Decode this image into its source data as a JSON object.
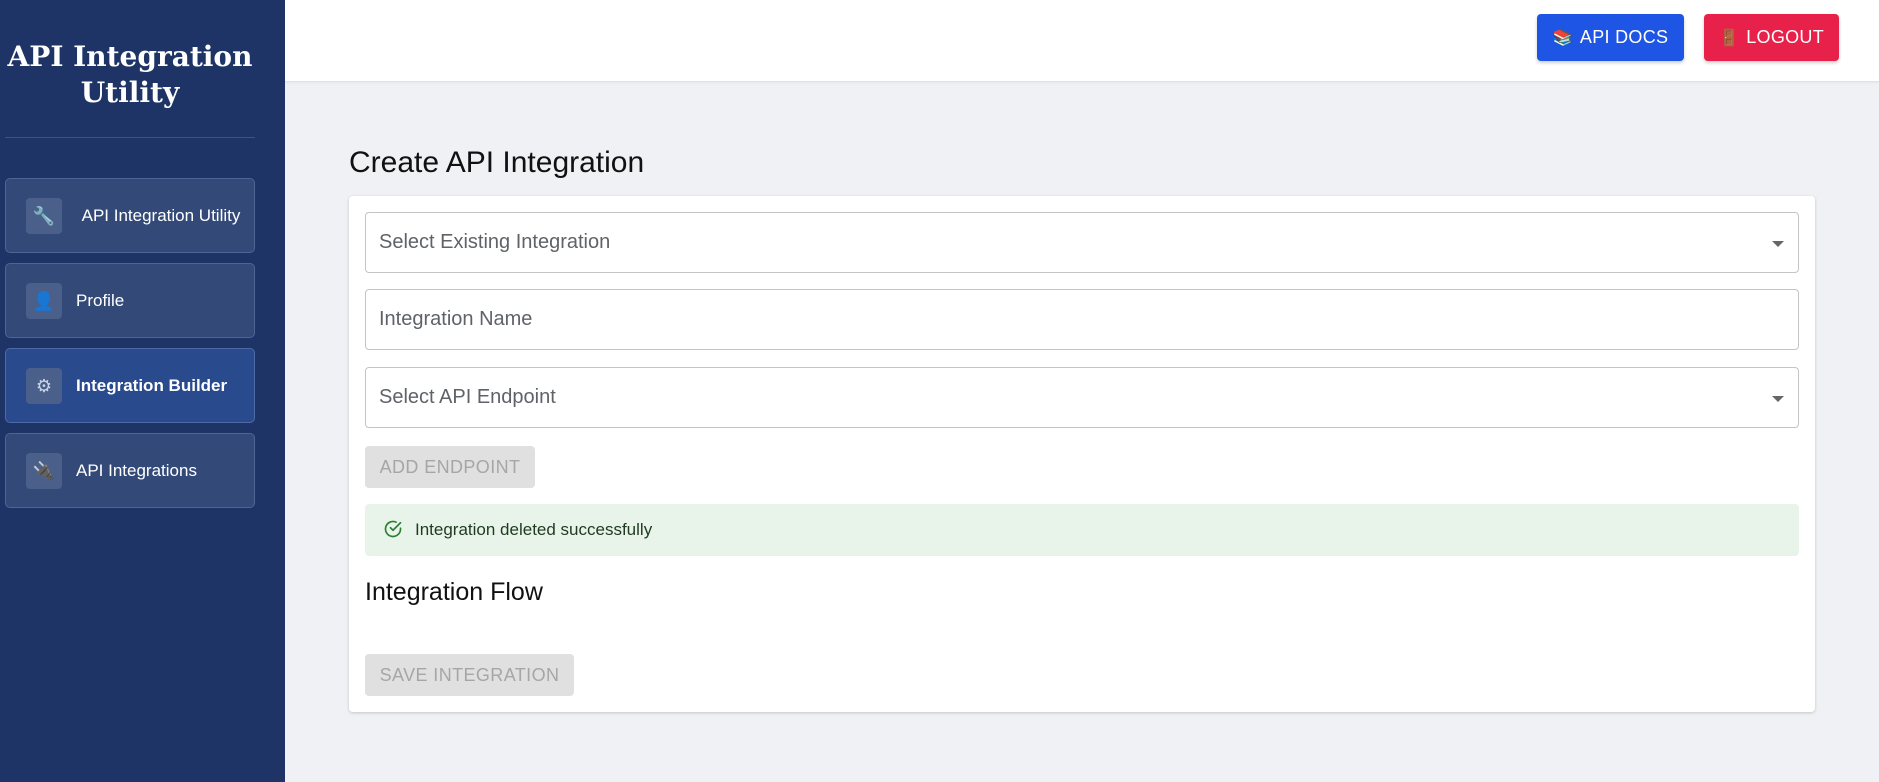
{
  "sidebar": {
    "brand": "API Integration Utility",
    "items": [
      {
        "label": "API Integration Utility",
        "icon": "wrench-icon",
        "glyph": "🔧"
      },
      {
        "label": "Profile",
        "icon": "user-icon",
        "glyph": "👤"
      },
      {
        "label": "Integration Builder",
        "icon": "gear-icon",
        "glyph": "⚙"
      },
      {
        "label": "API Integrations",
        "icon": "plug-icon",
        "glyph": "🔌"
      }
    ],
    "active_item": "Integration Builder"
  },
  "topbar": {
    "docs_label": "API DOCS",
    "docs_icon": "📚",
    "logout_label": "LOGOUT",
    "logout_icon": "🚪"
  },
  "main": {
    "title": "Create API Integration",
    "existing_integration_placeholder": "Select Existing Integration",
    "integration_name_placeholder": "Integration Name",
    "endpoint_placeholder": "Select API Endpoint",
    "add_endpoint_label": "ADD ENDPOINT",
    "alert_message": "Integration deleted successfully",
    "flow_title": "Integration Flow",
    "save_label": "SAVE INTEGRATION"
  },
  "colors": {
    "sidebar_bg": "#1e3466",
    "docs_button": "#1f55e4",
    "logout_button": "#e8214b",
    "success_bg": "#e8f4e9",
    "success_icon": "#2e7d32"
  }
}
